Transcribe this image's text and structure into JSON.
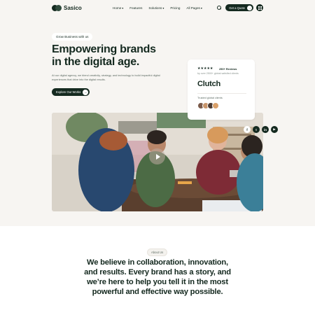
{
  "brand": {
    "name": "Sasico"
  },
  "nav": {
    "items": [
      {
        "label": "Home",
        "chevron": "▾"
      },
      {
        "label": "Features",
        "chevron": ""
      },
      {
        "label": "Solutions",
        "chevron": "▾"
      },
      {
        "label": "Pricing",
        "chevron": ""
      },
      {
        "label": "All Pages",
        "chevron": "▾"
      }
    ],
    "cta_label": "Get a Quote",
    "cta_arrow": "→"
  },
  "hero": {
    "tag": "Grow Business with us",
    "title_line1": "Empowering brands",
    "title_line2": "in the digital age.",
    "description": "At our digital agency, we blend creativity, strategy, and technology to build impactful digital experiences that drive into the digital results.",
    "button_label": "Explore Our Works",
    "button_arrow": "→"
  },
  "clutch": {
    "stars": "★★★★★",
    "reviews": "250+ Reviews",
    "reviews_sub": "by over 2500+ global satisfied clients",
    "logo": "Clutch",
    "trust_label": "Trusted global clients",
    "avatar_colors": [
      "#7a5a4a",
      "#c8956b",
      "#4a3a32",
      "#d9a06a"
    ]
  },
  "socials": [
    {
      "icon": "facebook-icon",
      "glyph": "f"
    },
    {
      "icon": "twitter-icon",
      "glyph": "t"
    },
    {
      "icon": "linkedin-icon",
      "glyph": "in"
    },
    {
      "icon": "youtube-icon",
      "glyph": "▶"
    }
  ],
  "about": {
    "tag": "About Us",
    "text": "We believe in collaboration, innovation, and results. Every brand has a story, and we’re here to help you tell it in the most powerful and effective way possible."
  },
  "colors": {
    "primary": "#14291f",
    "background": "#f7f5f2",
    "card": "#ffffff"
  }
}
